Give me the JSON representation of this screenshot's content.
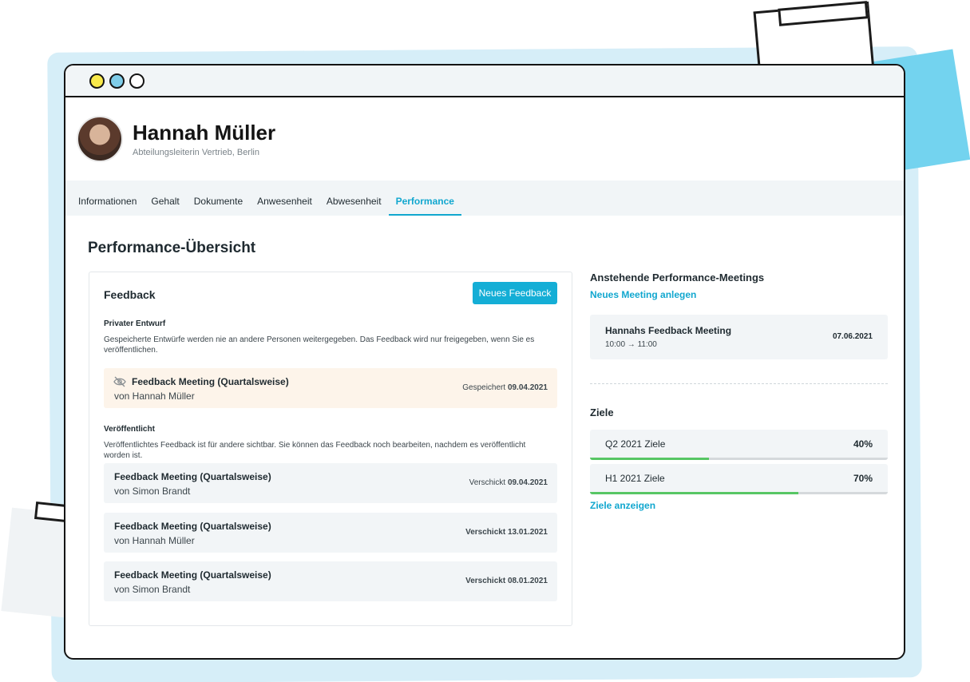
{
  "profile": {
    "name": "Hannah Müller",
    "subtitle": "Abteilungsleiterin Vertrieb, Berlin"
  },
  "tabs": [
    "Informationen",
    "Gehalt",
    "Dokumente",
    "Anwesenheit",
    "Abwesenheit",
    "Performance"
  ],
  "active_tab": "Performance",
  "page_title": "Performance-Übersicht",
  "feedback": {
    "title": "Feedback",
    "new_button": "Neues Feedback",
    "draft_section": {
      "heading": "Privater Entwurf",
      "description": "Gespeicherte Entwürfe werden nie an andere Personen weitergegeben. Das Feedback wird nur freigegeben, wenn Sie es veröffentlichen.",
      "item": {
        "title": "Feedback Meeting (Quartalsweise)",
        "by": "von Hannah Müller",
        "status_prefix": "Gespeichert",
        "status_date": "09.04.2021"
      }
    },
    "published_section": {
      "heading": "Veröffentlicht",
      "description": "Veröffentlichtes Feedback ist für andere sichtbar. Sie können das Feedback noch bearbeiten, nachdem es veröffentlicht worden ist.",
      "items": [
        {
          "title": "Feedback Meeting (Quartalsweise)",
          "by": "von Simon Brandt",
          "status_prefix": "Verschickt",
          "status_date": "09.04.2021"
        },
        {
          "title": "Feedback Meeting (Quartalsweise)",
          "by": "von Hannah Müller",
          "status_prefix": "Verschickt",
          "status_date": "13.01.2021"
        },
        {
          "title": "Feedback Meeting (Quartalsweise)",
          "by": "von Simon Brandt",
          "status_prefix": "Verschickt",
          "status_date": "08.01.2021"
        }
      ]
    }
  },
  "meetings": {
    "title": "Anstehende Performance-Meetings",
    "new_link": "Neues Meeting anlegen",
    "items": [
      {
        "title": "Hannahs Feedback Meeting",
        "time": "10:00 → 11:00",
        "date": "07.06.2021"
      }
    ]
  },
  "goals": {
    "title": "Ziele",
    "items": [
      {
        "label": "Q2 2021 Ziele",
        "percent_label": "40%",
        "progress": 0.4
      },
      {
        "label": "H1 2021 Ziele",
        "percent_label": "70%",
        "progress": 0.7
      }
    ],
    "show_link": "Ziele anzeigen"
  },
  "colors": {
    "accent": "#14aed6",
    "progress": "#57c664",
    "draft_bg": "#fdf4ea"
  }
}
